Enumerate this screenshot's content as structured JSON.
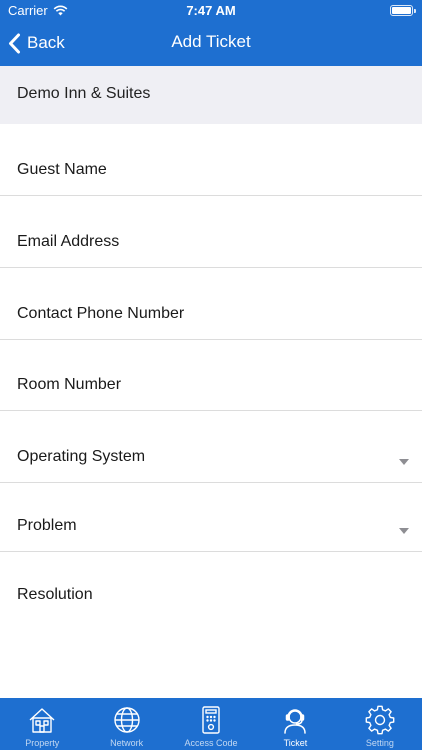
{
  "status_bar": {
    "carrier": "Carrier",
    "time": "7:47 AM"
  },
  "nav": {
    "back_label": "Back",
    "title": "Add Ticket"
  },
  "property": {
    "name": "Demo Inn & Suites"
  },
  "form": {
    "fields": [
      {
        "label": "Guest Name",
        "type": "text"
      },
      {
        "label": "Email Address",
        "type": "text"
      },
      {
        "label": "Contact Phone Number",
        "type": "text"
      },
      {
        "label": "Room Number",
        "type": "text"
      },
      {
        "label": "Operating System",
        "type": "dropdown"
      },
      {
        "label": "Problem",
        "type": "dropdown"
      },
      {
        "label": "Resolution",
        "type": "text"
      }
    ]
  },
  "tabs": [
    {
      "label": "Property",
      "icon": "house-icon"
    },
    {
      "label": "Network",
      "icon": "globe-icon"
    },
    {
      "label": "Access Code",
      "icon": "keypad-icon"
    },
    {
      "label": "Ticket",
      "icon": "headset-agent-icon",
      "active": true
    },
    {
      "label": "Setting",
      "icon": "gear-icon"
    }
  ],
  "colors": {
    "brand": "#1e6fd0",
    "band": "#efeff4",
    "divider": "#dcdcdc",
    "caret": "#8e8e93"
  }
}
